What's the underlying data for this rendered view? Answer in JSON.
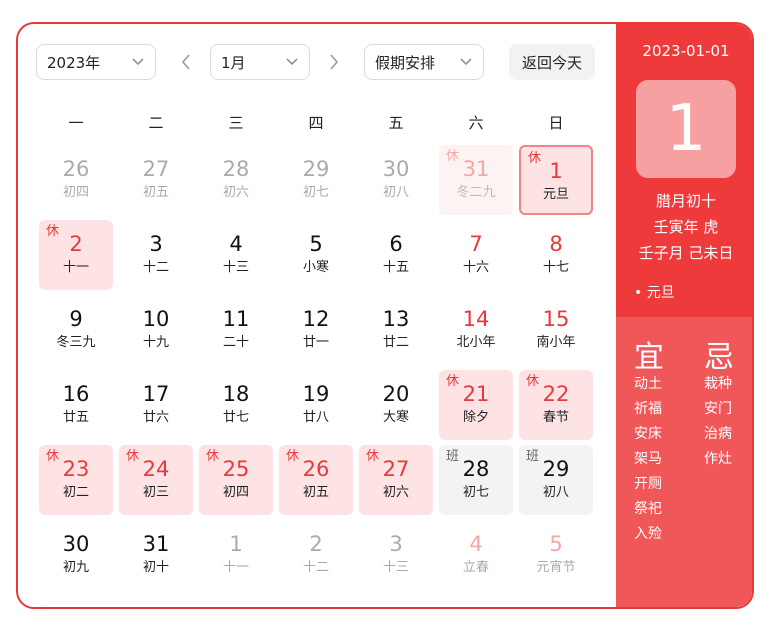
{
  "toolbar": {
    "year": "2023年",
    "month": "1月",
    "mode": "假期安排",
    "today": "返回今天"
  },
  "weekdays": [
    "一",
    "二",
    "三",
    "四",
    "五",
    "六",
    "日"
  ],
  "weeks": [
    [
      {
        "n": "26",
        "l": "初四",
        "cls": "other"
      },
      {
        "n": "27",
        "l": "初五",
        "cls": "other"
      },
      {
        "n": "28",
        "l": "初六",
        "cls": "other"
      },
      {
        "n": "29",
        "l": "初七",
        "cls": "other"
      },
      {
        "n": "30",
        "l": "初八",
        "cls": "other"
      },
      {
        "n": "31",
        "l": "冬二九",
        "cls": "holiday-faded",
        "tag": "休"
      },
      {
        "n": "1",
        "l": "元旦",
        "cls": "selected",
        "tag": "休"
      }
    ],
    [
      {
        "n": "2",
        "l": "十一",
        "cls": "holiday",
        "tag": "休"
      },
      {
        "n": "3",
        "l": "十二",
        "cls": ""
      },
      {
        "n": "4",
        "l": "十三",
        "cls": ""
      },
      {
        "n": "5",
        "l": "小寒",
        "cls": ""
      },
      {
        "n": "6",
        "l": "十五",
        "cls": ""
      },
      {
        "n": "7",
        "l": "十六",
        "cls": "red"
      },
      {
        "n": "8",
        "l": "十七",
        "cls": "red"
      }
    ],
    [
      {
        "n": "9",
        "l": "冬三九",
        "cls": ""
      },
      {
        "n": "10",
        "l": "十九",
        "cls": ""
      },
      {
        "n": "11",
        "l": "二十",
        "cls": ""
      },
      {
        "n": "12",
        "l": "廿一",
        "cls": ""
      },
      {
        "n": "13",
        "l": "廿二",
        "cls": ""
      },
      {
        "n": "14",
        "l": "北小年",
        "cls": "red"
      },
      {
        "n": "15",
        "l": "南小年",
        "cls": "red"
      }
    ],
    [
      {
        "n": "16",
        "l": "廿五",
        "cls": ""
      },
      {
        "n": "17",
        "l": "廿六",
        "cls": ""
      },
      {
        "n": "18",
        "l": "廿七",
        "cls": ""
      },
      {
        "n": "19",
        "l": "廿八",
        "cls": ""
      },
      {
        "n": "20",
        "l": "大寒",
        "cls": ""
      },
      {
        "n": "21",
        "l": "除夕",
        "cls": "holiday",
        "tag": "休"
      },
      {
        "n": "22",
        "l": "春节",
        "cls": "holiday",
        "tag": "休"
      }
    ],
    [
      {
        "n": "23",
        "l": "初二",
        "cls": "holiday",
        "tag": "休"
      },
      {
        "n": "24",
        "l": "初三",
        "cls": "holiday",
        "tag": "休"
      },
      {
        "n": "25",
        "l": "初四",
        "cls": "holiday",
        "tag": "休"
      },
      {
        "n": "26",
        "l": "初五",
        "cls": "holiday",
        "tag": "休"
      },
      {
        "n": "27",
        "l": "初六",
        "cls": "holiday",
        "tag": "休"
      },
      {
        "n": "28",
        "l": "初七",
        "cls": "work",
        "tag": "班"
      },
      {
        "n": "29",
        "l": "初八",
        "cls": "work",
        "tag": "班"
      }
    ],
    [
      {
        "n": "30",
        "l": "初九",
        "cls": ""
      },
      {
        "n": "31",
        "l": "初十",
        "cls": ""
      },
      {
        "n": "1",
        "l": "十一",
        "cls": "other"
      },
      {
        "n": "2",
        "l": "十二",
        "cls": "other"
      },
      {
        "n": "3",
        "l": "十三",
        "cls": "other"
      },
      {
        "n": "4",
        "l": "立春",
        "cls": "other-red"
      },
      {
        "n": "5",
        "l": "元宵节",
        "cls": "other-red"
      }
    ]
  ],
  "panel": {
    "date": "2023-01-01",
    "day": "1",
    "lunar": "腊月初十",
    "ganzhi_year": "壬寅年 虎",
    "ganzhi_month_day": "壬子月 己未日",
    "festival": "• 元旦",
    "yi_title": "宜",
    "ji_title": "忌",
    "yi": [
      "动土",
      "祈福",
      "安床",
      "架马",
      "开厕",
      "祭祀",
      "入殓"
    ],
    "ji": [
      "栽种",
      "安门",
      "治病",
      "作灶"
    ]
  },
  "colors": {
    "accent": "#e8393a",
    "panel_top": "#ee3a3b",
    "panel_bottom": "#f05759",
    "holiday_bg": "#fde3e4",
    "work_bg": "#f3f3f3"
  }
}
